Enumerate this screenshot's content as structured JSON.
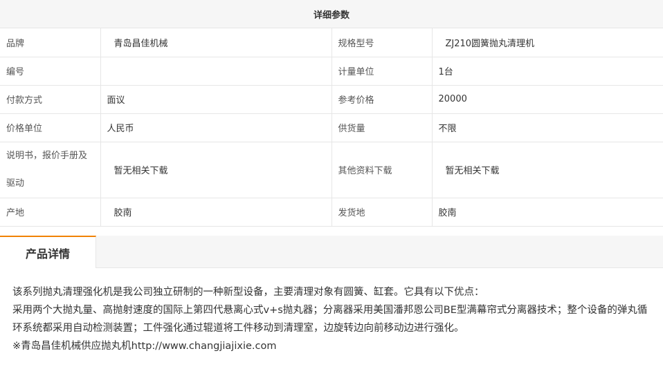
{
  "params": {
    "title": "详细参数",
    "rows": [
      {
        "k1": "品牌",
        "v1": "青岛昌佳机械",
        "k2": "规格型号",
        "v2": "ZJ210圆簧抛丸清理机"
      },
      {
        "k1": "编号",
        "v1": "",
        "k2": "计量单位",
        "v2": "1台"
      },
      {
        "k1": "付款方式",
        "v1": "面议",
        "k2": "参考价格",
        "v2": "20000"
      },
      {
        "k1": "价格单位",
        "v1": "人民币",
        "k2": "供货量",
        "v2": "不限"
      },
      {
        "k1": "说明书，报价手册及驱动",
        "v1": "暂无相关下载",
        "k2": "其他资料下载",
        "v2": "暂无相关下载"
      },
      {
        "k1": "产地",
        "v1": "胶南",
        "k2": "发货地",
        "v2": "胶南"
      }
    ]
  },
  "detail": {
    "tab_label": "产品详情",
    "paragraphs": [
      "该系列抛丸清理强化机是我公司独立研制的一种新型设备，主要清理对象有圆簧、缸套。它具有以下优点：",
      "采用两个大抛丸量、高抛射速度的国际上第四代悬离心式v+s抛丸器；分离器采用美国潘邦恩公司BE型满幕帘式分离器技术；整个设备的弹丸循环系统都采用自动检测装置；工件强化通过辊道将工件移动到清理室，边旋转边向前移动边进行强化。",
      "※青岛昌佳机械供应抛丸机http://www.changjiajixie.com"
    ]
  }
}
